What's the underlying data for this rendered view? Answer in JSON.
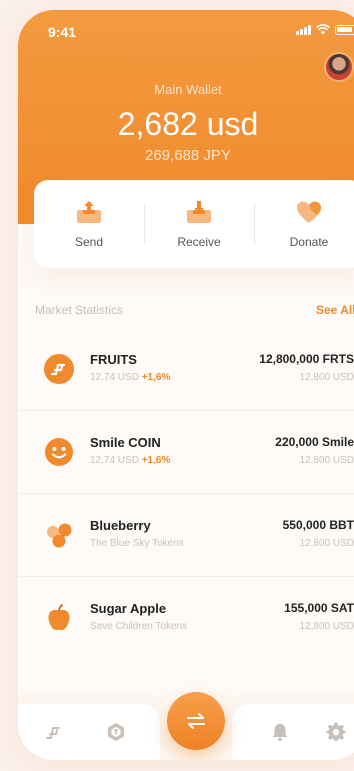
{
  "status": {
    "time": "9:41"
  },
  "wallet": {
    "label": "Main Wallet",
    "balance": "2,682 usd",
    "secondary": "269,688 JPY"
  },
  "actions": [
    {
      "label": "Send",
      "icon": "send-icon"
    },
    {
      "label": "Receive",
      "icon": "receive-icon"
    },
    {
      "label": "Donate",
      "icon": "heart-icon"
    }
  ],
  "market": {
    "title": "Market Statistics",
    "see_all": "See All",
    "items": [
      {
        "name": "FRUITS",
        "sub": "12,74 USD",
        "change": "+1,6%",
        "amount": "12,800,000 FRTS",
        "usd": "12,800 USD",
        "icon": "fruits-logo-icon"
      },
      {
        "name": "Smile COIN",
        "sub": "12,74 USD",
        "change": "+1,6%",
        "amount": "220,000 Smile",
        "usd": "12,800 USD",
        "icon": "smile-icon"
      },
      {
        "name": "Blueberry",
        "sub": "The Blue Sky Tokens",
        "change": "",
        "amount": "550,000 BBT",
        "usd": "12,800 USD",
        "icon": "blueberry-icon"
      },
      {
        "name": "Sugar Apple",
        "sub": "Save Children Tokens",
        "change": "",
        "amount": "155,000 SAT",
        "usd": "12,800 USD",
        "icon": "apple-icon"
      }
    ]
  },
  "nav": {
    "items": [
      "chart-icon",
      "token-icon",
      "swap-icon",
      "bell-icon",
      "gear-icon"
    ]
  },
  "colors": {
    "accent": "#f08a2c",
    "background": "#fdfaf8"
  }
}
